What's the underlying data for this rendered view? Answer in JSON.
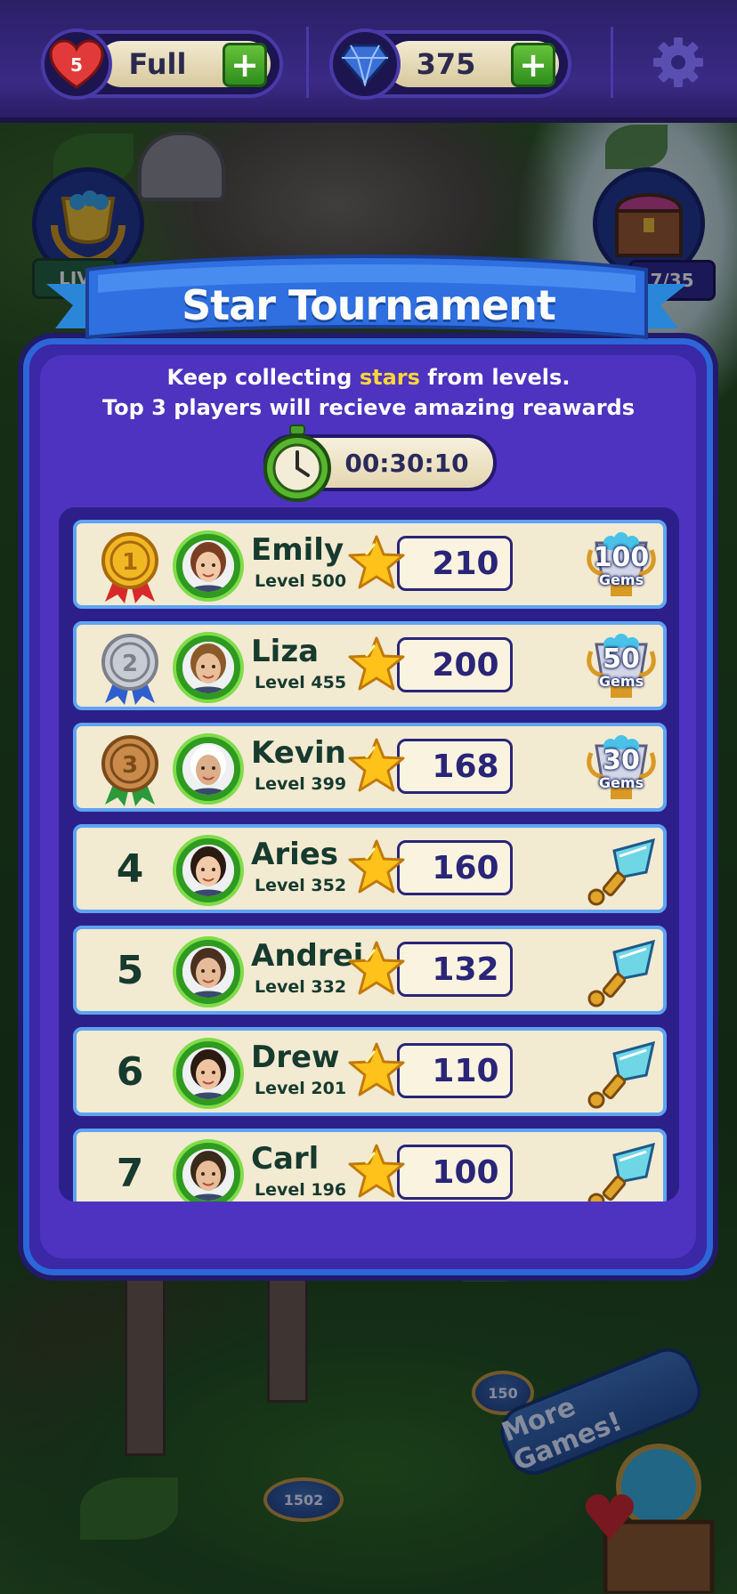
{
  "topbar": {
    "lives": {
      "count": "5",
      "status": "Full"
    },
    "gems": {
      "value": "375"
    },
    "plus_label": "+"
  },
  "side": {
    "left_badge_label": "LIV",
    "right_badge_label": "7/35"
  },
  "tournament": {
    "title": "Star Tournament",
    "description_line1_prefix": "Keep collecting ",
    "description_line1_highlight": "stars",
    "description_line1_suffix": " from levels.",
    "description_line2": "Top 3 players will recieve amazing reawards",
    "timer": "00:30:10",
    "players": [
      {
        "rank": "1",
        "name": "Emily",
        "level": "Level 500",
        "stars": "210",
        "reward_amount": "100",
        "reward_unit": "Gems",
        "medal": "gold"
      },
      {
        "rank": "2",
        "name": "Liza",
        "level": "Level 455",
        "stars": "200",
        "reward_amount": "50",
        "reward_unit": "Gems",
        "medal": "silver"
      },
      {
        "rank": "3",
        "name": "Kevin",
        "level": "Level 399",
        "stars": "168",
        "reward_amount": "30",
        "reward_unit": "Gems",
        "medal": "bronze"
      },
      {
        "rank": "4",
        "name": "Aries",
        "level": "Level 352",
        "stars": "160",
        "reward": "shovel-booster"
      },
      {
        "rank": "5",
        "name": "Andrei",
        "level": "Level 332",
        "stars": "132",
        "reward": "shovel-booster"
      },
      {
        "rank": "6",
        "name": "Drew",
        "level": "Level 201",
        "stars": "110",
        "reward": "shovel-booster"
      },
      {
        "rank": "7",
        "name": "Carl",
        "level": "Level 196",
        "stars": "100",
        "reward": "shovel-booster"
      }
    ]
  },
  "map": {
    "more_games_label": "More Games!",
    "level_pads": [
      "1502",
      "150"
    ]
  },
  "colors": {
    "panel": "#4d33bf",
    "row": "#f3ead2",
    "highlight": "#ffd43b",
    "accent_green": "#2e9a1f"
  }
}
